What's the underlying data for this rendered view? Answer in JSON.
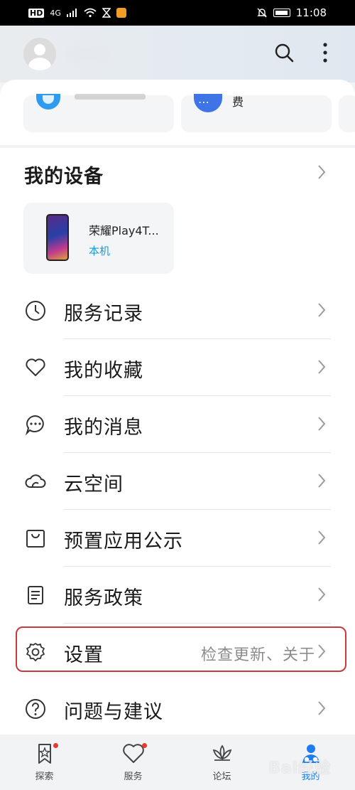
{
  "status_bar": {
    "network_label": "HD",
    "signal_label": "4G",
    "time": "11:08"
  },
  "header": {
    "avatar": "avatar-placeholder",
    "icons": [
      "search-icon",
      "more-vertical-icon"
    ]
  },
  "service_tiles": [
    {
      "icon": "blue-service-icon",
      "label": ""
    },
    {
      "icon": "blue-dots-icon",
      "label": "费"
    }
  ],
  "my_devices": {
    "title": "我的设备",
    "device": {
      "name": "荣耀Play4T...",
      "tag": "本机"
    }
  },
  "menu": [
    {
      "icon": "clock-icon",
      "label": "服务记录",
      "sub": ""
    },
    {
      "icon": "heart-icon",
      "label": "我的收藏",
      "sub": ""
    },
    {
      "icon": "message-icon",
      "label": "我的消息",
      "sub": ""
    },
    {
      "icon": "cloud-icon",
      "label": "云空间",
      "sub": ""
    },
    {
      "icon": "bag-icon",
      "label": "预置应用公示",
      "sub": ""
    },
    {
      "icon": "document-icon",
      "label": "服务政策",
      "sub": ""
    },
    {
      "icon": "gear-icon",
      "label": "设置",
      "sub": "检查更新、关于"
    },
    {
      "icon": "question-icon",
      "label": "问题与建议",
      "sub": ""
    }
  ],
  "tabbar": [
    {
      "icon": "star-bookmark-icon",
      "label": "探索",
      "badge": true
    },
    {
      "icon": "heart-tab-icon",
      "label": "服务",
      "badge": true
    },
    {
      "icon": "lotus-icon",
      "label": "论坛",
      "badge": false
    },
    {
      "icon": "person-tab-icon",
      "label": "我的",
      "badge": false,
      "active": true
    }
  ],
  "colors": {
    "accent": "#1e7cf2",
    "highlight": "#c9383e",
    "badge": "#e8392e",
    "device_tag": "#1e9bd0"
  },
  "watermark": "Bai经验"
}
